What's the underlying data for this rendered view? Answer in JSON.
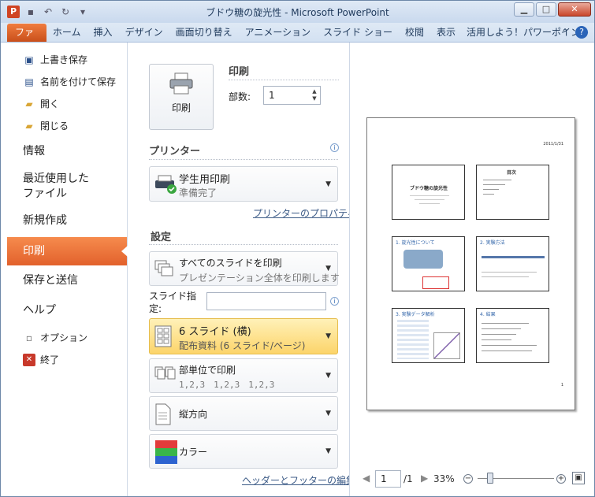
{
  "window": {
    "title": "ブドウ糖の旋光性 - Microsoft PowerPoint"
  },
  "ribbon": {
    "file_tab": "ファイル",
    "tabs": [
      "ホーム",
      "挿入",
      "デザイン",
      "画面切り替え",
      "アニメーション",
      "スライド ショー",
      "校閲",
      "表示",
      "活用しよう！パワーポイント"
    ]
  },
  "backstage": {
    "commands": [
      {
        "label": "上書き保存",
        "icon": "save-icon"
      },
      {
        "label": "名前を付けて保存",
        "icon": "save-as-icon"
      },
      {
        "label": "開く",
        "icon": "open-folder-icon"
      },
      {
        "label": "閉じる",
        "icon": "close-folder-icon"
      }
    ],
    "info": "情報",
    "recent_line1": "最近使用した",
    "recent_line2": "ファイル",
    "new": "新規作成",
    "print": "印刷",
    "save_send": "保存と送信",
    "help": "ヘルプ",
    "options": "オプション",
    "exit": "終了"
  },
  "print": {
    "section_title": "印刷",
    "button_label": "印刷",
    "copies_label": "部数:",
    "copies_value": "1",
    "printer_header": "プリンター",
    "printer_name": "学生用印刷",
    "printer_status": "準備完了",
    "printer_properties": "プリンターのプロパティ",
    "settings_header": "設定",
    "range_title": "すべてのスライドを印刷",
    "range_desc": "プレゼンテーション全体を印刷します",
    "slides_label_1": "スライド指",
    "slides_label_2": "定:",
    "layout_title": "6 スライド (横)",
    "layout_desc": "配布資料 (6 スライド/ページ)",
    "collate_title": "部単位で印刷",
    "collate_desc": "1,2,3　1,2,3　1,2,3",
    "orientation": "縦方向",
    "color": "カラー",
    "header_footer": "ヘッダーとフッターの編集"
  },
  "preview": {
    "date": "2011/1/31",
    "page_number": "1",
    "slides": [
      {
        "title": "ブドウ糖の旋光性"
      },
      {
        "title": "目次"
      },
      {
        "title": "1. 旋光性について"
      },
      {
        "title": "2. 実験方法"
      },
      {
        "title": "3. 実験データ解析"
      },
      {
        "title": "4. 結果"
      }
    ],
    "page_current": "1",
    "page_total": "/1",
    "zoom": "33%"
  },
  "colors": {
    "accent_orange": "#e2612c",
    "highlight": "#fcd46a",
    "link": "#3b5a86"
  }
}
